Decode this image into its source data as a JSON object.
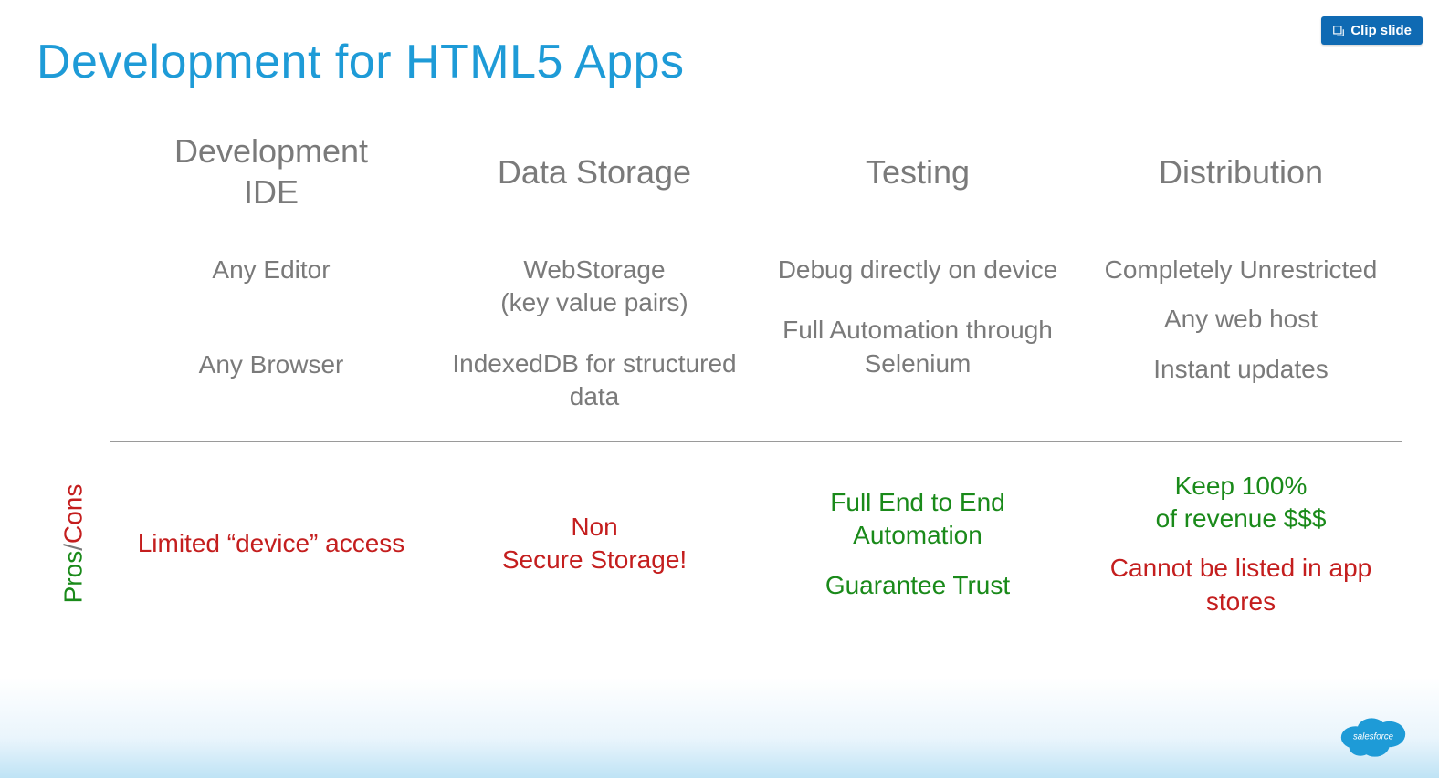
{
  "clip_button": "Clip slide",
  "title": "Development for HTML5 Apps",
  "proscons_label": {
    "pros": "Pros",
    "slash": "/",
    "cons": "Cons"
  },
  "columns": [
    {
      "header": "Development\nIDE",
      "features": [
        "Any Editor",
        "Any Browser"
      ],
      "proscons": [
        {
          "type": "con",
          "text": "Limited “device” access"
        }
      ]
    },
    {
      "header": "Data Storage",
      "features": [
        "WebStorage\n(key value pairs)",
        "IndexedDB for structured data"
      ],
      "proscons": [
        {
          "type": "con",
          "text": "Non\nSecure Storage!"
        }
      ]
    },
    {
      "header": "Testing",
      "features": [
        "Debug directly on device",
        "Full Automation through Selenium"
      ],
      "proscons": [
        {
          "type": "pro",
          "text": "Full End to End Automation"
        },
        {
          "type": "pro",
          "text": "Guarantee Trust"
        }
      ]
    },
    {
      "header": "Distribution",
      "features": [
        "Completely Unrestricted",
        "Any web host",
        "Instant updates"
      ],
      "proscons": [
        {
          "type": "pro",
          "text": "Keep 100%\nof revenue $$$"
        },
        {
          "type": "con",
          "text": "Cannot be listed in app stores"
        }
      ]
    }
  ],
  "logo_text": "salesforce"
}
